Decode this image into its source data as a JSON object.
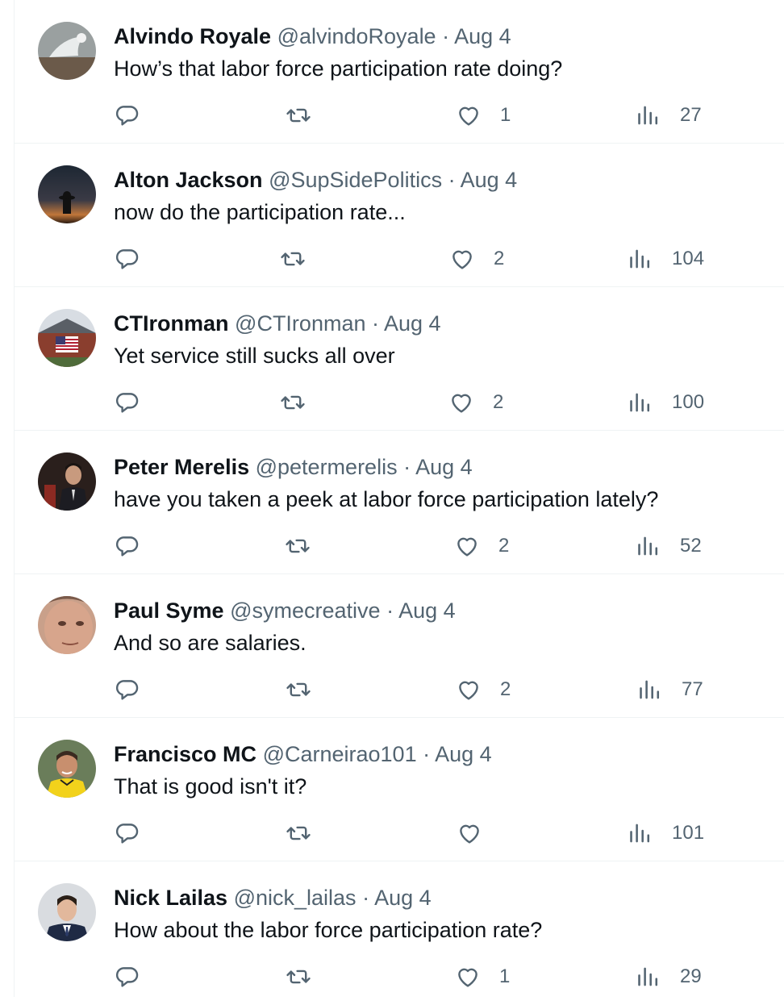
{
  "tweets": [
    {
      "name": "Alvindo Royale",
      "handle": "@alvindoRoyale",
      "date": "Aug 4",
      "text": "How’s that labor force participation rate doing?",
      "likes": "1",
      "views": "27",
      "avatar": "bird-photo"
    },
    {
      "name": "Alton Jackson",
      "handle": "@SupSidePolitics",
      "date": "Aug 4",
      "text": "now do the participation rate...",
      "likes": "2",
      "views": "104",
      "avatar": "cowboy-silhouette-sunset"
    },
    {
      "name": "CTIronman",
      "handle": "@CTIronman",
      "date": "Aug 4",
      "text": "Yet service still sucks all over",
      "likes": "2",
      "views": "100",
      "avatar": "house-with-flag"
    },
    {
      "name": "Peter Merelis",
      "handle": "@petermerelis",
      "date": "Aug 4",
      "text": "have you taken a peek at labor force participation lately?",
      "likes": "2",
      "views": "52",
      "avatar": "man-in-suit-dark-room"
    },
    {
      "name": "Paul Syme",
      "handle": "@symecreative",
      "date": "Aug 4",
      "text": "And so are salaries.",
      "likes": "2",
      "views": "77",
      "avatar": "face-closeup"
    },
    {
      "name": "Francisco MC",
      "handle": "@Carneirao101",
      "date": "Aug 4",
      "text": "That is good isn't it?",
      "likes": "",
      "views": "101",
      "avatar": "man-yellow-jersey"
    },
    {
      "name": "Nick Lailas",
      "handle": "@nick_lailas",
      "date": "Aug 4",
      "text": "How about the labor force participation rate?",
      "likes": "1",
      "views": "29",
      "avatar": "man-in-suit-portrait"
    }
  ],
  "icons": {
    "reply": "reply-icon",
    "retweet": "retweet-icon",
    "like": "heart-icon",
    "views": "views-chart-icon"
  },
  "colors": {
    "text": "#0f1419",
    "secondary": "#536471",
    "divider": "#eff3f4"
  }
}
